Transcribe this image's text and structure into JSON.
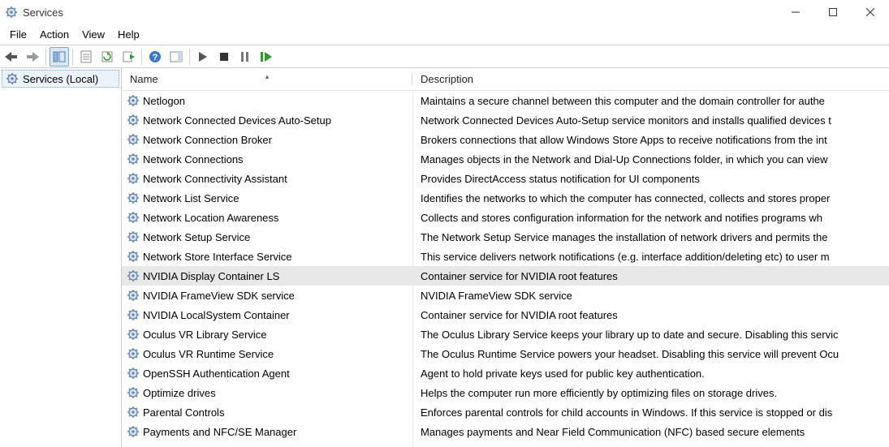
{
  "window": {
    "title": "Services"
  },
  "menu": {
    "file": "File",
    "action": "Action",
    "view": "View",
    "help": "Help"
  },
  "sidebar": {
    "root": "Services (Local)"
  },
  "columns": {
    "name": "Name",
    "description": "Description"
  },
  "selected_index": 9,
  "services": [
    {
      "name": "Netlogon",
      "desc": "Maintains a secure channel between this computer and the domain controller for authe"
    },
    {
      "name": "Network Connected Devices Auto-Setup",
      "desc": "Network Connected Devices Auto-Setup service monitors and installs qualified devices t"
    },
    {
      "name": "Network Connection Broker",
      "desc": "Brokers connections that allow Windows Store Apps to receive notifications from the int"
    },
    {
      "name": "Network Connections",
      "desc": "Manages objects in the Network and Dial-Up Connections folder, in which you can view"
    },
    {
      "name": "Network Connectivity Assistant",
      "desc": "Provides DirectAccess status notification for UI components"
    },
    {
      "name": "Network List Service",
      "desc": "Identifies the networks to which the computer has connected, collects and stores proper"
    },
    {
      "name": "Network Location Awareness",
      "desc": "Collects and stores configuration information for the network and notifies programs wh"
    },
    {
      "name": "Network Setup Service",
      "desc": "The Network Setup Service manages the installation of network drivers and permits the"
    },
    {
      "name": "Network Store Interface Service",
      "desc": "This service delivers network notifications (e.g. interface addition/deleting etc) to user m"
    },
    {
      "name": "NVIDIA Display Container LS",
      "desc": "Container service for NVIDIA root features"
    },
    {
      "name": "NVIDIA FrameView SDK service",
      "desc": "NVIDIA FrameView SDK service"
    },
    {
      "name": "NVIDIA LocalSystem Container",
      "desc": "Container service for NVIDIA root features"
    },
    {
      "name": "Oculus VR Library Service",
      "desc": "The Oculus Library Service keeps your library up to date and secure. Disabling this servic"
    },
    {
      "name": "Oculus VR Runtime Service",
      "desc": "The Oculus Runtime Service powers your headset. Disabling this service will prevent Ocu"
    },
    {
      "name": "OpenSSH Authentication Agent",
      "desc": "Agent to hold private keys used for public key authentication."
    },
    {
      "name": "Optimize drives",
      "desc": "Helps the computer run more efficiently by optimizing files on storage drives."
    },
    {
      "name": "Parental Controls",
      "desc": "Enforces parental controls for child accounts in Windows. If this service is stopped or dis"
    },
    {
      "name": "Payments and NFC/SE Manager",
      "desc": "Manages payments and Near Field Communication (NFC) based secure elements"
    }
  ]
}
